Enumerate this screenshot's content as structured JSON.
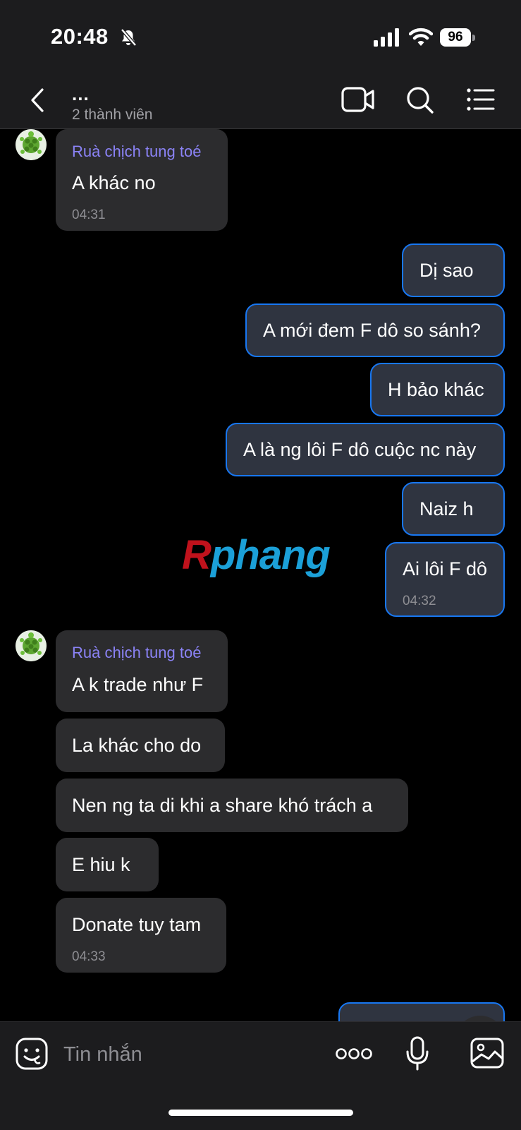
{
  "status_bar": {
    "time": "20:48",
    "battery": "96"
  },
  "header": {
    "more": "...",
    "subtitle": "2 thành viên"
  },
  "watermark": {
    "part1": "R",
    "part2": "phang"
  },
  "messages": [
    {
      "sender": "Ruà chịch tung toé",
      "text": "A khác no",
      "time": "04:31"
    },
    {
      "text": "Dị sao"
    },
    {
      "text": "A mới đem F dô so sánh?"
    },
    {
      "text": "H bảo khác"
    },
    {
      "text": "A là ng lôi F dô cuộc nc này"
    },
    {
      "text": "Naiz h"
    },
    {
      "text": "Ai lôi F dô",
      "time": "04:32"
    },
    {
      "sender": "Ruà chịch tung toé",
      "text": "A k trade như F"
    },
    {
      "text": "La khác cho do"
    },
    {
      "text": "Nen ng ta di khi a share khó trách a"
    },
    {
      "text": "E hiu k"
    },
    {
      "text": "Donate tuy tam",
      "time": "04:33"
    }
  ],
  "composer": {
    "placeholder": "Tin nhắn"
  },
  "colors": {
    "sender_name": "#8b83f6",
    "outgoing_border": "#1877f2"
  }
}
